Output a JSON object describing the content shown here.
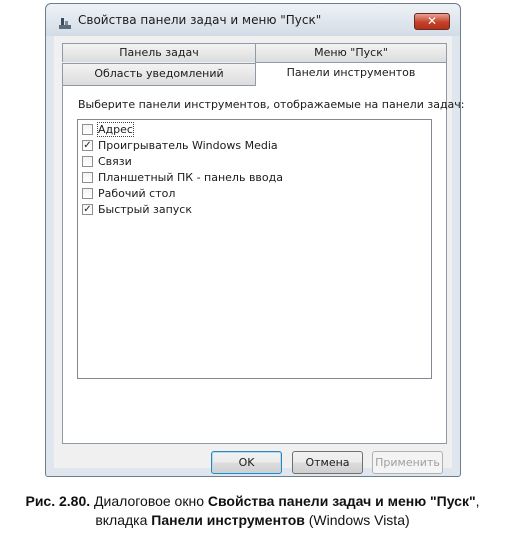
{
  "window": {
    "title": "Свойства панели задач и меню \"Пуск\"",
    "close_glyph": "✕"
  },
  "tabs": {
    "back_row": [
      "Панель задач",
      "Меню \"Пуск\""
    ],
    "front_row": [
      "Область уведомлений",
      "Панели инструментов"
    ],
    "active": "Панели инструментов"
  },
  "panel": {
    "description": "Выберите панели инструментов, отображаемые на панели задач:",
    "toolbars": [
      {
        "label": "Адрес",
        "checked": false
      },
      {
        "label": "Проигрыватель Windows Media",
        "checked": true
      },
      {
        "label": "Связи",
        "checked": false
      },
      {
        "label": "Планшетный ПК - панель ввода",
        "checked": false
      },
      {
        "label": "Рабочий стол",
        "checked": false
      },
      {
        "label": "Быстрый запуск",
        "checked": true
      }
    ]
  },
  "buttons": {
    "ok": "OK",
    "cancel": "Отмена",
    "apply": "Применить"
  },
  "caption": {
    "prefix": "Рис. 2.80.",
    "text1": " Диалоговое окно ",
    "bold1": "Свойства панели задач и меню \"Пуск\"",
    "text2": ",",
    "text3": "вкладка ",
    "bold2": "Панели инструментов",
    "text4": " (Windows Vista)"
  },
  "colors": {
    "accent": "#3c7fb1",
    "close": "#c4412b"
  }
}
